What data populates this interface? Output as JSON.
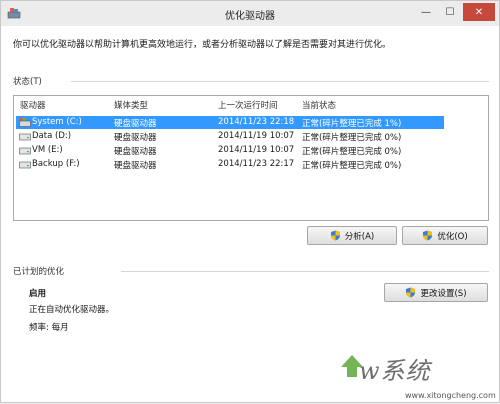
{
  "window": {
    "title": "优化驱动器",
    "controls": {
      "minimize": "—",
      "maximize": "☐",
      "close": "✕"
    }
  },
  "description": "你可以优化驱动器以帮助计算机更高效地运行，或者分析驱动器以了解是否需要对其进行优化。",
  "status_section": {
    "label": "状态(T)",
    "columns": [
      "驱动器",
      "媒体类型",
      "上一次运行时间",
      "当前状态"
    ],
    "rows": [
      {
        "drive": "System (C:)",
        "media": "硬盘驱动器",
        "last_run": "2014/11/23 22:18",
        "status": "正常(碎片整理已完成 1%)",
        "selected": true
      },
      {
        "drive": "Data (D:)",
        "media": "硬盘驱动器",
        "last_run": "2014/11/19 10:07",
        "status": "正常(碎片整理已完成 0%)",
        "selected": false
      },
      {
        "drive": "VM (E:)",
        "media": "硬盘驱动器",
        "last_run": "2014/11/19 10:07",
        "status": "正常(碎片整理已完成 0%)",
        "selected": false
      },
      {
        "drive": "Backup (F:)",
        "media": "硬盘驱动器",
        "last_run": "2014/11/23 22:17",
        "status": "正常(碎片整理已完成 0%)",
        "selected": false
      }
    ],
    "analyze_button": "分析(A)",
    "optimize_button": "优化(O)"
  },
  "scheduled_section": {
    "label": "已计划的优化",
    "state": "启用",
    "detail": "正在自动优化驱动器。",
    "frequency": "频率: 每月",
    "change_settings_button": "更改设置(S)"
  },
  "watermark": {
    "text": "w系统",
    "url": "www.xitongcheng.com"
  },
  "colors": {
    "selection": "#3399ff",
    "close_button": "#c7483c"
  }
}
